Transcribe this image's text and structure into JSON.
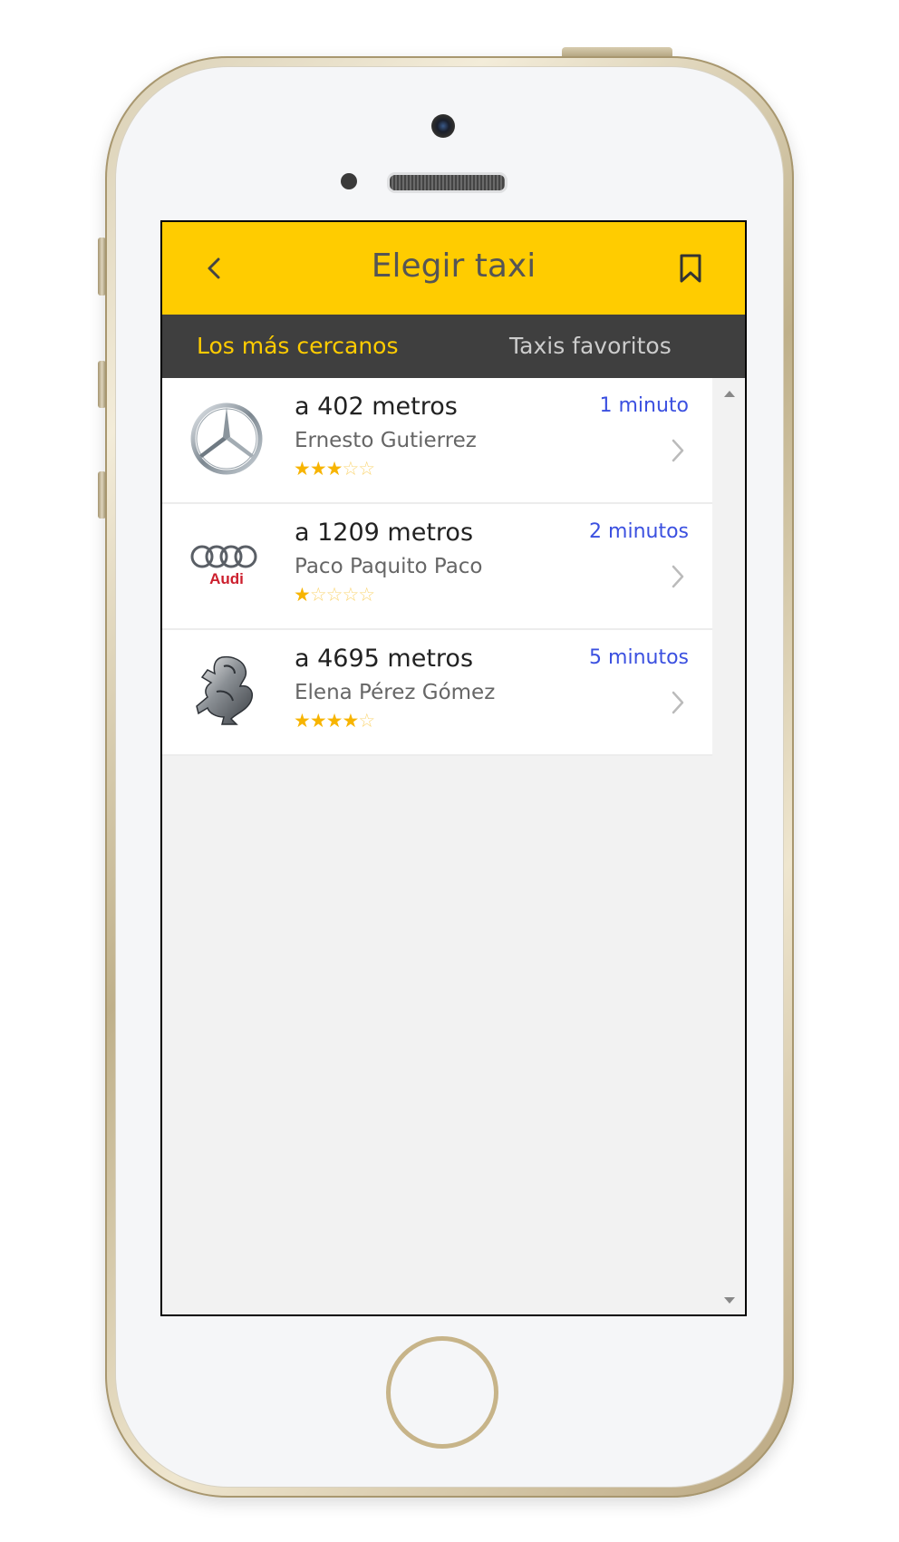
{
  "header": {
    "title": "Elegir taxi",
    "back_icon": "chevron-left-icon",
    "bookmark_icon": "bookmark-icon",
    "background_color": "#ffcc00"
  },
  "tabs": [
    {
      "label": "Los más cercanos",
      "active": true,
      "color": "#ffcc00"
    },
    {
      "label": "Taxis favoritos",
      "active": false,
      "color": "#cccccc"
    }
  ],
  "taxis": [
    {
      "brand_logo": "mercedes-logo",
      "distance": "a 402 metros",
      "driver": "Ernesto Gutierrez",
      "rating": 3,
      "rating_max": 5,
      "stars_text_on": "★★★",
      "stars_text_off": "☆☆",
      "eta": "1 minuto"
    },
    {
      "brand_logo": "audi-logo",
      "logo_text": "Audi",
      "distance": "a 1209 metros",
      "driver": "Paco Paquito Paco",
      "rating": 1,
      "rating_max": 5,
      "stars_text_on": "★",
      "stars_text_off": "☆☆☆☆",
      "eta": "2 minutos"
    },
    {
      "brand_logo": "peugeot-logo",
      "distance": "a 4695 metros",
      "driver": "Elena Pérez Gómez",
      "rating": 4,
      "rating_max": 5,
      "stars_text_on": "★★★★",
      "stars_text_off": "☆",
      "eta": "5 minutos"
    }
  ],
  "colors": {
    "eta": "#3b50e0",
    "star": "#f7b400",
    "tab_bar": "#3f3f3f"
  }
}
